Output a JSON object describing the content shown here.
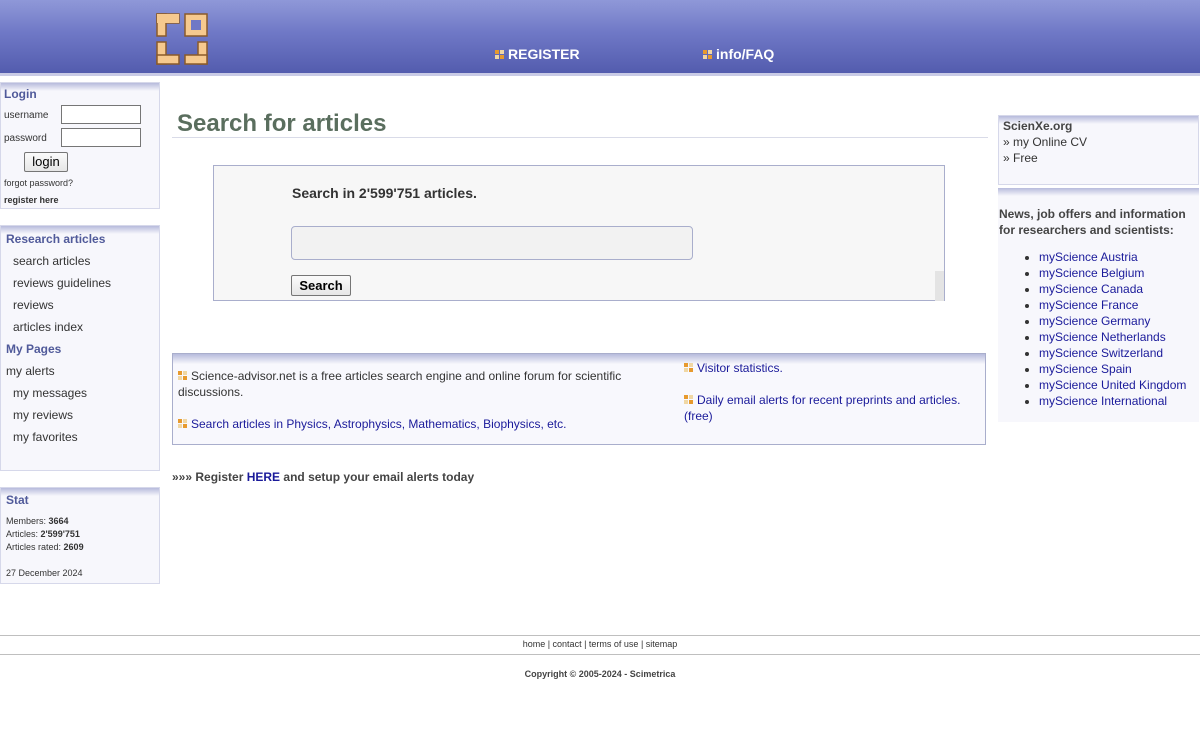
{
  "header": {
    "nav": [
      {
        "label": "REGISTER"
      },
      {
        "label": "info/FAQ"
      }
    ]
  },
  "login": {
    "title": "Login",
    "username_label": "username",
    "password_label": "password",
    "button": "login",
    "forgot": "forgot password?",
    "register": "register here"
  },
  "menu": {
    "research_heading": "Research articles",
    "research_items": [
      "search articles",
      "reviews guidelines",
      "reviews",
      "articles index"
    ],
    "mypages_heading": "My Pages",
    "alerts": "my alerts",
    "mypages_items": [
      "my messages",
      "my reviews",
      "my favorites"
    ]
  },
  "stat": {
    "title": "Stat",
    "members_label": "Members:",
    "members_value": "3664",
    "articles_label": "Articles:",
    "articles_value": "2'599'751",
    "rated_label": "Articles rated:",
    "rated_value": "2609",
    "date": "27 December 2024"
  },
  "main": {
    "title": "Search for articles",
    "search_label": "Search in 2'599'751 articles.",
    "search_value": "",
    "search_button": "Search",
    "info_left_1": "Science-advisor.net is a free articles search engine and online forum for scientific discussions.",
    "info_left_2": "Search articles in Physics, Astrophysics, Mathematics, Biophysics, etc.",
    "info_right_1": "Visitor statistics.",
    "info_right_2": "Daily email alerts for recent preprints and articles. (free)",
    "register_prefix": "»»» Register ",
    "register_link": "HERE",
    "register_suffix": " and setup your email alerts today"
  },
  "right": {
    "scienxe_title": "ScienXe.org",
    "cv": "» my Online CV",
    "free": "» Free",
    "news_heading": "News, job offers and information for researchers and scientists:",
    "sites": [
      "myScience Austria",
      "myScience Belgium",
      "myScience Canada",
      "myScience France",
      "myScience Germany",
      "myScience Netherlands",
      "myScience Switzerland",
      "myScience Spain",
      "myScience United Kingdom",
      "myScience International"
    ]
  },
  "footer": {
    "links": [
      "home",
      "contact",
      "terms of use",
      "sitemap"
    ],
    "copyright": "Copyright © 2005-2024 - Scimetrica"
  },
  "colors": {
    "header": "#6f78c6",
    "title": "#5a6e5e",
    "box_title": "#505a9a",
    "link": "#1a1a9a"
  }
}
